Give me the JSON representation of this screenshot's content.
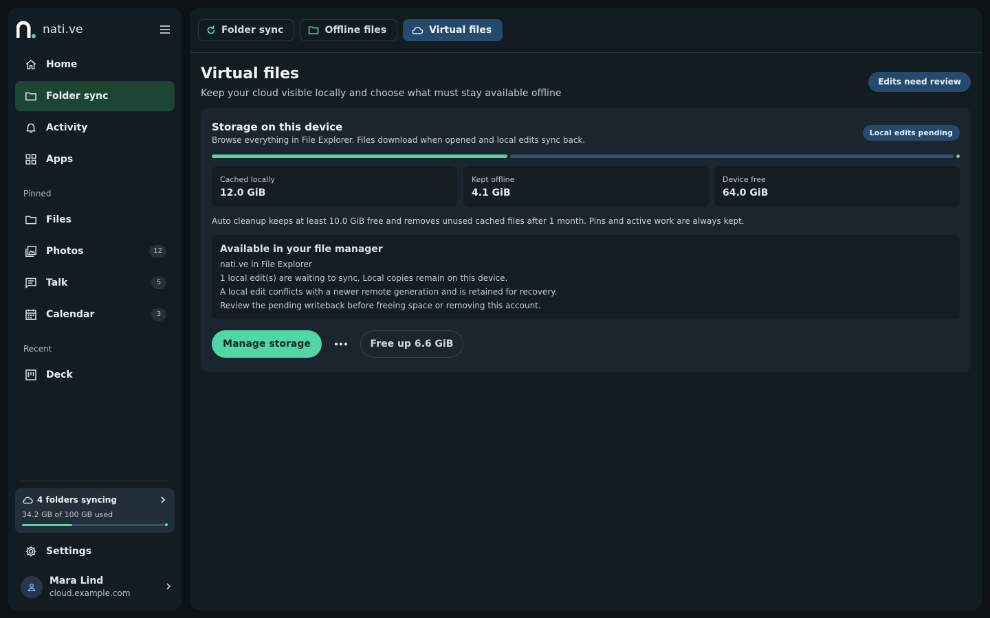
{
  "app": {
    "brand_name": "nati.ve"
  },
  "sidebar": {
    "nav": [
      {
        "label": "Home",
        "icon": "home-icon"
      },
      {
        "label": "Folder sync",
        "icon": "folder-icon",
        "active": true
      },
      {
        "label": "Activity",
        "icon": "bell-icon"
      },
      {
        "label": "Apps",
        "icon": "apps-grid-icon"
      }
    ],
    "pinned_label": "Pinned",
    "pinned": [
      {
        "label": "Files",
        "icon": "folder-icon"
      },
      {
        "label": "Photos",
        "icon": "photos-icon",
        "count": "12"
      },
      {
        "label": "Talk",
        "icon": "chat-icon",
        "count": "5"
      },
      {
        "label": "Calendar",
        "icon": "calendar-icon",
        "count": "3"
      }
    ],
    "recent_label": "Recent",
    "recent": [
      {
        "label": "Deck",
        "icon": "deck-icon"
      }
    ],
    "sync_card": {
      "title": "4 folders syncing",
      "usage": "34.2 GB of 100 GB used",
      "used_fraction": 0.342
    },
    "settings_label": "Settings",
    "profile": {
      "name": "Mara Lind",
      "host": "cloud.example.com"
    }
  },
  "tabs": [
    {
      "label": "Folder sync",
      "icon": "refresh-icon"
    },
    {
      "label": "Offline files",
      "icon": "folder-icon"
    },
    {
      "label": "Virtual files",
      "icon": "cloud-icon",
      "active": true
    }
  ],
  "page": {
    "title": "Virtual files",
    "subtitle": "Keep your cloud visible locally and choose what must stay available offline",
    "review_badge": "Edits need review"
  },
  "storage": {
    "title": "Storage on this device",
    "subtitle": "Browse everything in File Explorer. Files download when opened and local edits sync back.",
    "badge": "Local edits pending",
    "cached_fraction": 0.395,
    "stats": [
      {
        "label": "Cached locally",
        "value": "12.0 GiB"
      },
      {
        "label": "Kept offline",
        "value": "4.1 GiB"
      },
      {
        "label": "Device free",
        "value": "64.0 GiB"
      }
    ],
    "cleanup_note": "Auto cleanup keeps at least 10.0 GiB free and removes unused cached files after 1 month. Pins and active work are always kept.",
    "file_manager": {
      "heading": "Available in your file manager",
      "lines": [
        "nati.ve in File Explorer",
        "1 local edit(s) are waiting to sync. Local copies remain on this device.",
        "A local edit conflicts with a newer remote generation and is retained for recovery.",
        "Review the pending writeback before freeing space or removing this account."
      ]
    },
    "actions": {
      "manage": "Manage storage",
      "free_up": "Free up 6.6 GiB"
    }
  },
  "colors": {
    "accent": "#52d6a8",
    "active_nav": "#1d4533",
    "active_tab": "#264a6b",
    "background": "#0d1216"
  }
}
